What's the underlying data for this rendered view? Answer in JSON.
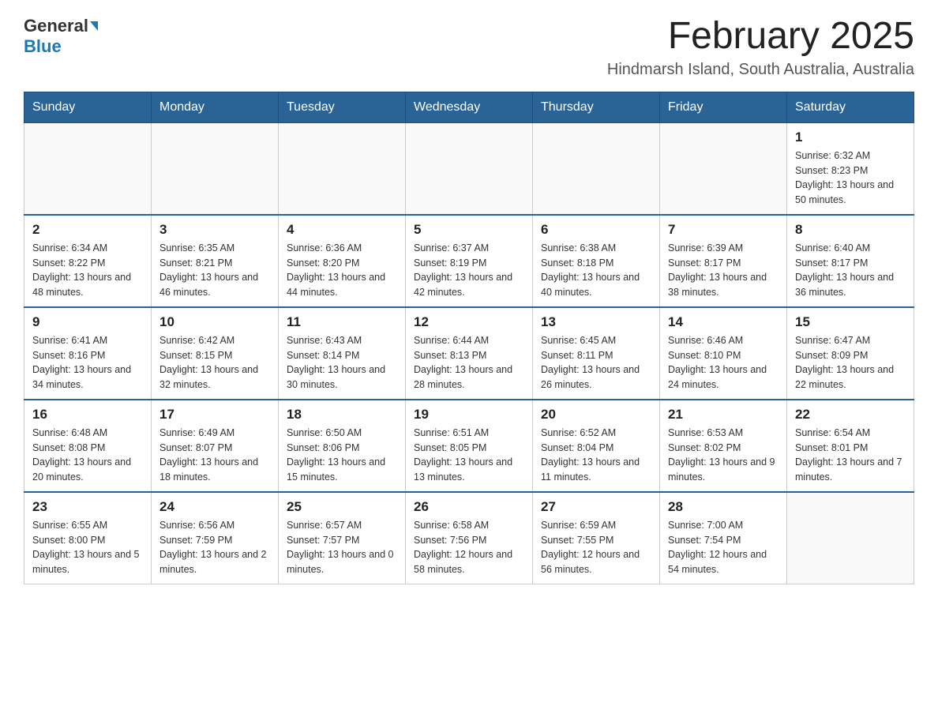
{
  "header": {
    "logo_general": "General",
    "logo_blue": "Blue",
    "title": "February 2025",
    "subtitle": "Hindmarsh Island, South Australia, Australia"
  },
  "days_of_week": [
    "Sunday",
    "Monday",
    "Tuesday",
    "Wednesday",
    "Thursday",
    "Friday",
    "Saturday"
  ],
  "weeks": [
    [
      {
        "day": "",
        "info": ""
      },
      {
        "day": "",
        "info": ""
      },
      {
        "day": "",
        "info": ""
      },
      {
        "day": "",
        "info": ""
      },
      {
        "day": "",
        "info": ""
      },
      {
        "day": "",
        "info": ""
      },
      {
        "day": "1",
        "info": "Sunrise: 6:32 AM\nSunset: 8:23 PM\nDaylight: 13 hours and 50 minutes."
      }
    ],
    [
      {
        "day": "2",
        "info": "Sunrise: 6:34 AM\nSunset: 8:22 PM\nDaylight: 13 hours and 48 minutes."
      },
      {
        "day": "3",
        "info": "Sunrise: 6:35 AM\nSunset: 8:21 PM\nDaylight: 13 hours and 46 minutes."
      },
      {
        "day": "4",
        "info": "Sunrise: 6:36 AM\nSunset: 8:20 PM\nDaylight: 13 hours and 44 minutes."
      },
      {
        "day": "5",
        "info": "Sunrise: 6:37 AM\nSunset: 8:19 PM\nDaylight: 13 hours and 42 minutes."
      },
      {
        "day": "6",
        "info": "Sunrise: 6:38 AM\nSunset: 8:18 PM\nDaylight: 13 hours and 40 minutes."
      },
      {
        "day": "7",
        "info": "Sunrise: 6:39 AM\nSunset: 8:17 PM\nDaylight: 13 hours and 38 minutes."
      },
      {
        "day": "8",
        "info": "Sunrise: 6:40 AM\nSunset: 8:17 PM\nDaylight: 13 hours and 36 minutes."
      }
    ],
    [
      {
        "day": "9",
        "info": "Sunrise: 6:41 AM\nSunset: 8:16 PM\nDaylight: 13 hours and 34 minutes."
      },
      {
        "day": "10",
        "info": "Sunrise: 6:42 AM\nSunset: 8:15 PM\nDaylight: 13 hours and 32 minutes."
      },
      {
        "day": "11",
        "info": "Sunrise: 6:43 AM\nSunset: 8:14 PM\nDaylight: 13 hours and 30 minutes."
      },
      {
        "day": "12",
        "info": "Sunrise: 6:44 AM\nSunset: 8:13 PM\nDaylight: 13 hours and 28 minutes."
      },
      {
        "day": "13",
        "info": "Sunrise: 6:45 AM\nSunset: 8:11 PM\nDaylight: 13 hours and 26 minutes."
      },
      {
        "day": "14",
        "info": "Sunrise: 6:46 AM\nSunset: 8:10 PM\nDaylight: 13 hours and 24 minutes."
      },
      {
        "day": "15",
        "info": "Sunrise: 6:47 AM\nSunset: 8:09 PM\nDaylight: 13 hours and 22 minutes."
      }
    ],
    [
      {
        "day": "16",
        "info": "Sunrise: 6:48 AM\nSunset: 8:08 PM\nDaylight: 13 hours and 20 minutes."
      },
      {
        "day": "17",
        "info": "Sunrise: 6:49 AM\nSunset: 8:07 PM\nDaylight: 13 hours and 18 minutes."
      },
      {
        "day": "18",
        "info": "Sunrise: 6:50 AM\nSunset: 8:06 PM\nDaylight: 13 hours and 15 minutes."
      },
      {
        "day": "19",
        "info": "Sunrise: 6:51 AM\nSunset: 8:05 PM\nDaylight: 13 hours and 13 minutes."
      },
      {
        "day": "20",
        "info": "Sunrise: 6:52 AM\nSunset: 8:04 PM\nDaylight: 13 hours and 11 minutes."
      },
      {
        "day": "21",
        "info": "Sunrise: 6:53 AM\nSunset: 8:02 PM\nDaylight: 13 hours and 9 minutes."
      },
      {
        "day": "22",
        "info": "Sunrise: 6:54 AM\nSunset: 8:01 PM\nDaylight: 13 hours and 7 minutes."
      }
    ],
    [
      {
        "day": "23",
        "info": "Sunrise: 6:55 AM\nSunset: 8:00 PM\nDaylight: 13 hours and 5 minutes."
      },
      {
        "day": "24",
        "info": "Sunrise: 6:56 AM\nSunset: 7:59 PM\nDaylight: 13 hours and 2 minutes."
      },
      {
        "day": "25",
        "info": "Sunrise: 6:57 AM\nSunset: 7:57 PM\nDaylight: 13 hours and 0 minutes."
      },
      {
        "day": "26",
        "info": "Sunrise: 6:58 AM\nSunset: 7:56 PM\nDaylight: 12 hours and 58 minutes."
      },
      {
        "day": "27",
        "info": "Sunrise: 6:59 AM\nSunset: 7:55 PM\nDaylight: 12 hours and 56 minutes."
      },
      {
        "day": "28",
        "info": "Sunrise: 7:00 AM\nSunset: 7:54 PM\nDaylight: 12 hours and 54 minutes."
      },
      {
        "day": "",
        "info": ""
      }
    ]
  ]
}
